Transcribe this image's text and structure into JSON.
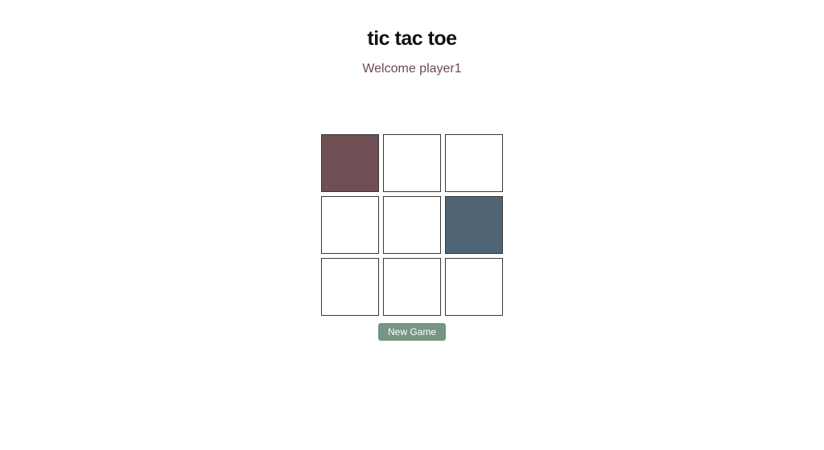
{
  "title": "tic tac toe",
  "welcome": "Welcome player1",
  "board": {
    "cells": [
      {
        "state": "red"
      },
      {
        "state": ""
      },
      {
        "state": ""
      },
      {
        "state": ""
      },
      {
        "state": ""
      },
      {
        "state": "blue"
      },
      {
        "state": ""
      },
      {
        "state": ""
      },
      {
        "state": ""
      }
    ]
  },
  "new_game_label": "New Game",
  "colors": {
    "player1": "#6f4f54",
    "player2": "#4f6576",
    "button": "#749683"
  }
}
